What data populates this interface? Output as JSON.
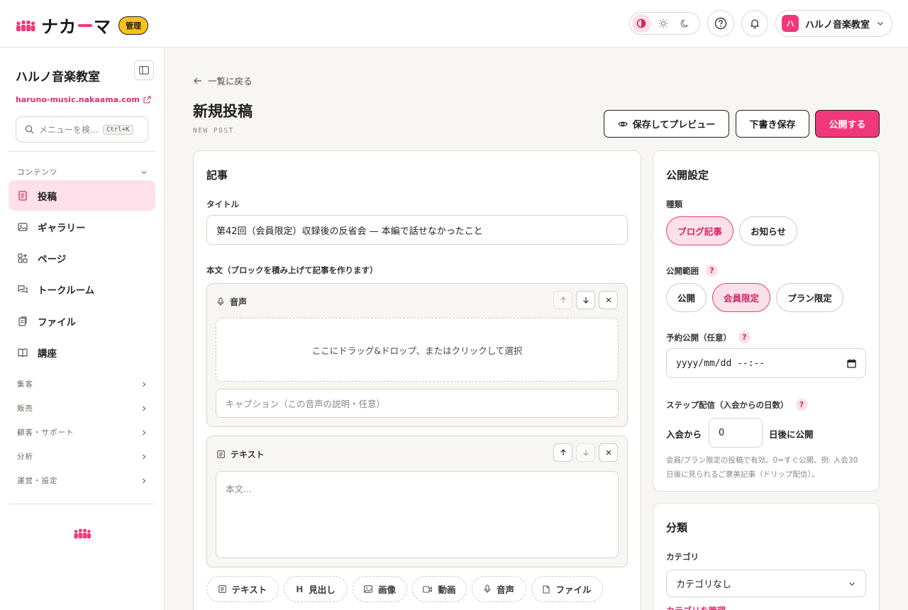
{
  "header": {
    "brand_name_a": "ナカ",
    "brand_name_b": "マ",
    "admin_badge": "管理",
    "account_avatar": "ハ",
    "account_name": "ハルノ音楽教室"
  },
  "sidebar": {
    "title": "ハルノ音楽教室",
    "url": "haruno-music.nakaama.com",
    "search_placeholder": "メニューを検…",
    "search_shortcut": "Ctrl+K",
    "content_group": "コンテンツ",
    "items": [
      {
        "label": "投稿",
        "icon": "post-icon"
      },
      {
        "label": "ギャラリー",
        "icon": "gallery-icon"
      },
      {
        "label": "ページ",
        "icon": "pages-icon"
      },
      {
        "label": "トークルーム",
        "icon": "chat-icon"
      },
      {
        "label": "ファイル",
        "icon": "file-icon"
      },
      {
        "label": "講座",
        "icon": "book-icon"
      }
    ],
    "groups": [
      "集客",
      "販売",
      "顧客・サポート",
      "分析",
      "運営・設定"
    ]
  },
  "main": {
    "back_label": "一覧に戻る",
    "title": "新規投稿",
    "subtitle": "NEW POST",
    "preview_button": "保存してプレビュー",
    "draft_button": "下書き保存",
    "publish_button": "公開する"
  },
  "article": {
    "heading": "記事",
    "title_label": "タイトル",
    "title_value": "第42回（会員限定）収録後の反省会 — 本編で話せなかったこと",
    "body_label": "本文（ブロックを積み上げて記事を作ります）",
    "audio_block": {
      "label": "音声",
      "dropzone": "ここにドラッグ&ドロップ、またはクリックして選択",
      "caption_placeholder": "キャプション（この音声の説明・任意）"
    },
    "text_block": {
      "label": "テキスト",
      "placeholder": "本文..."
    },
    "add_blocks": [
      "テキスト",
      "見出し",
      "画像",
      "動画",
      "音声",
      "ファイル"
    ]
  },
  "publish": {
    "heading": "公開設定",
    "type_label": "種類",
    "types": [
      "ブログ記事",
      "お知らせ"
    ],
    "type_selected": "ブログ記事",
    "scope_label": "公開範囲",
    "scopes": [
      "公開",
      "会員限定",
      "プラン限定"
    ],
    "scope_selected": "会員限定",
    "schedule_label": "予約公開（任意）",
    "schedule_placeholder": "yyyy/mm/dd --:--",
    "step_label": "ステップ配信（入会からの日数）",
    "step_prefix": "入会から",
    "step_value": "0",
    "step_suffix": "日後に公開",
    "step_hint_1": "会員/プラン限定の投稿で有効。0=すぐ公開。例: 入会30",
    "step_hint_2": "日後に見られるご褒美記事（ドリップ配信）。"
  },
  "classification": {
    "heading": "分類",
    "category_label": "カテゴリ",
    "category_value": "カテゴリなし",
    "manage_link": "カテゴリを管理"
  },
  "colors": {
    "accent": "#f0387a",
    "accent_soft": "#fde0ea",
    "badge": "#f7c21b"
  }
}
